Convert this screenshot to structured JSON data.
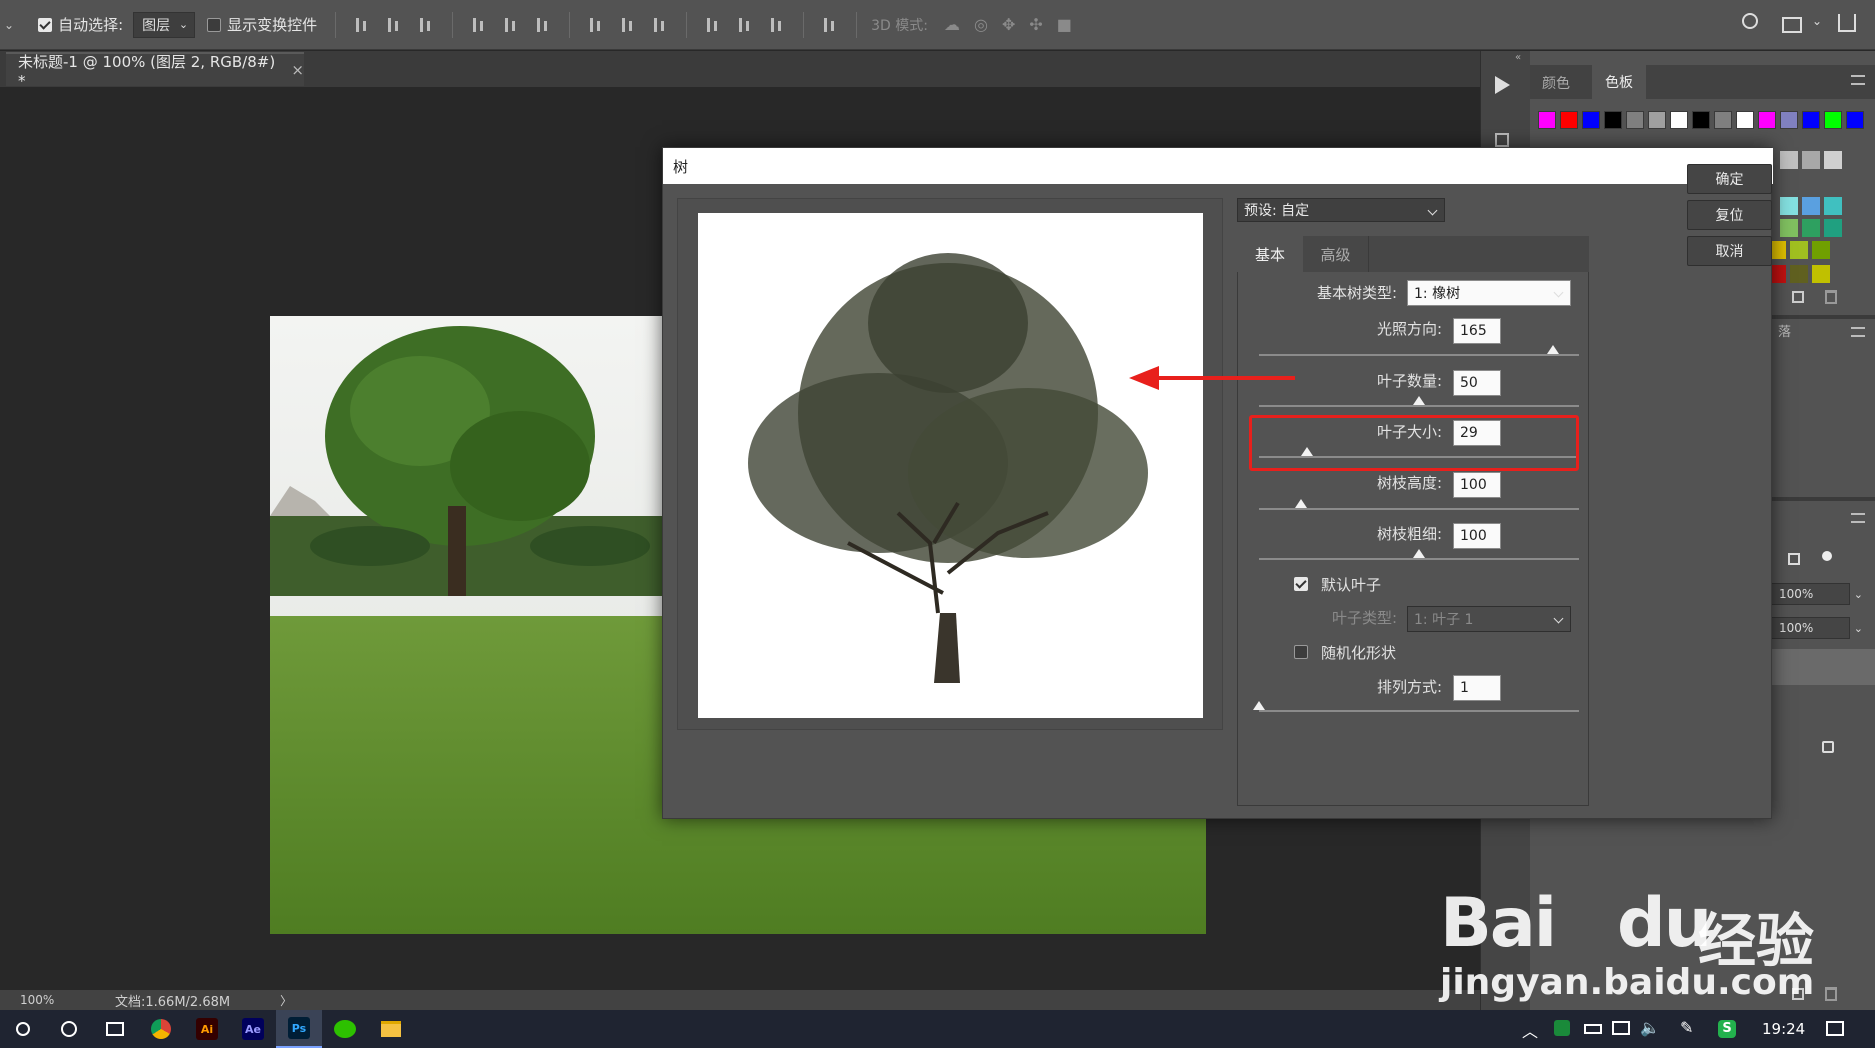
{
  "optbar": {
    "auto_select_label": "自动选择:",
    "auto_select_value": "图层",
    "show_transform_label": "显示变换控件",
    "mode3d_label": "3D 模式:"
  },
  "doc": {
    "tab_title": "未标题-1 @ 100% (图层 2, RGB/8#) *",
    "close": "×"
  },
  "status": {
    "zoom": "100%",
    "doc_size": "文档:1.66M/2.68M",
    "arrow": "〉"
  },
  "panels": {
    "tab_color": "颜色",
    "tab_swatches": "色板",
    "layers_frag": "落",
    "opacity": "100%",
    "fill": "100%",
    "swatch_colors": [
      "#ff00ff",
      "#ff0000",
      "#0000ff",
      "#000000",
      "#808080",
      "#a0a0a0",
      "#ffffff",
      "#000000",
      "#808080",
      "#ffffff",
      "#ff00ff",
      "#8080c0",
      "#0000ff",
      "#00ff00",
      "#0000ff"
    ]
  },
  "dialog": {
    "title": "树",
    "preset_label": "预设: 自定",
    "tab_basic": "基本",
    "tab_advanced": "高级",
    "tree_type_label": "基本树类型:",
    "tree_type_value": "1: 橡树",
    "light_dir_label": "光照方向:",
    "light_dir_value": "165",
    "light_dir_level": 0.92,
    "leaf_count_label": "叶子数量:",
    "leaf_count_value": "50",
    "leaf_count_level": 0.5,
    "leaf_size_label": "叶子大小:",
    "leaf_size_value": "29",
    "leaf_size_level": 0.15,
    "branch_height_label": "树枝高度:",
    "branch_height_value": "100",
    "branch_height_level": 0.13,
    "branch_thick_label": "树枝粗细:",
    "branch_thick_value": "100",
    "branch_thick_level": 0.5,
    "default_leaf_label": "默认叶子",
    "leaf_type_label": "叶子类型:",
    "leaf_type_value": "1: 叶子 1",
    "randomize_label": "随机化形状",
    "arrange_label": "排列方式:",
    "arrange_value": "1",
    "arrange_level": 0.0,
    "ok": "确定",
    "reset": "复位",
    "cancel": "取消"
  },
  "taskbar": {
    "apps": [
      "Ai",
      "Ae",
      "Ps"
    ],
    "time": "19:24"
  },
  "watermark": {
    "brand": "Bai",
    "brand2": "du",
    "cn": "经验",
    "url": "jingyan.baidu.com"
  }
}
